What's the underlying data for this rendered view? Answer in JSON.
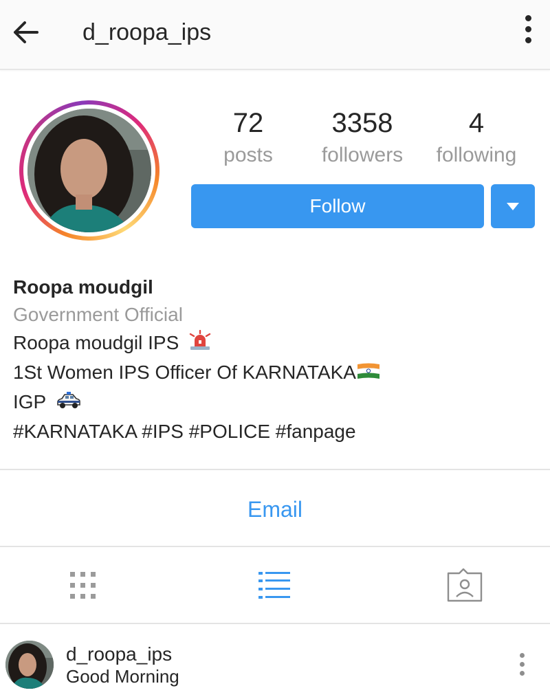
{
  "header": {
    "username": "d_roopa_ips",
    "back_icon": "arrow-left-icon",
    "menu_icon": "more-vertical-icon"
  },
  "profile": {
    "stats": [
      {
        "value": "72",
        "label": "posts"
      },
      {
        "value": "3358",
        "label": "followers"
      },
      {
        "value": "4",
        "label": "following"
      }
    ],
    "follow_label": "Follow",
    "dropdown_icon": "caret-down-icon"
  },
  "bio": {
    "name": "Roopa moudgil",
    "category": "Government Official",
    "lines": [
      "Roopa moudgil IPS",
      "1St Women IPS Officer Of KARNATAKA",
      "IGP",
      "#KARNATAKA #IPS #POLICE #fanpage"
    ],
    "emojis": [
      "police-siren-emoji",
      "india-flag-emoji",
      "police-car-emoji"
    ]
  },
  "contact": {
    "email_label": "Email"
  },
  "tabs": [
    {
      "name": "grid-view",
      "icon": "grid-icon",
      "active": false
    },
    {
      "name": "list-view",
      "icon": "list-icon",
      "active": true
    },
    {
      "name": "tagged",
      "icon": "tagged-person-icon",
      "active": false
    }
  ],
  "post": {
    "username": "d_roopa_ips",
    "caption": "Good Morning"
  },
  "colors": {
    "accent": "#3897f0",
    "text": "#262626",
    "muted": "#9a9a9a",
    "divider": "#e4e4e4"
  }
}
